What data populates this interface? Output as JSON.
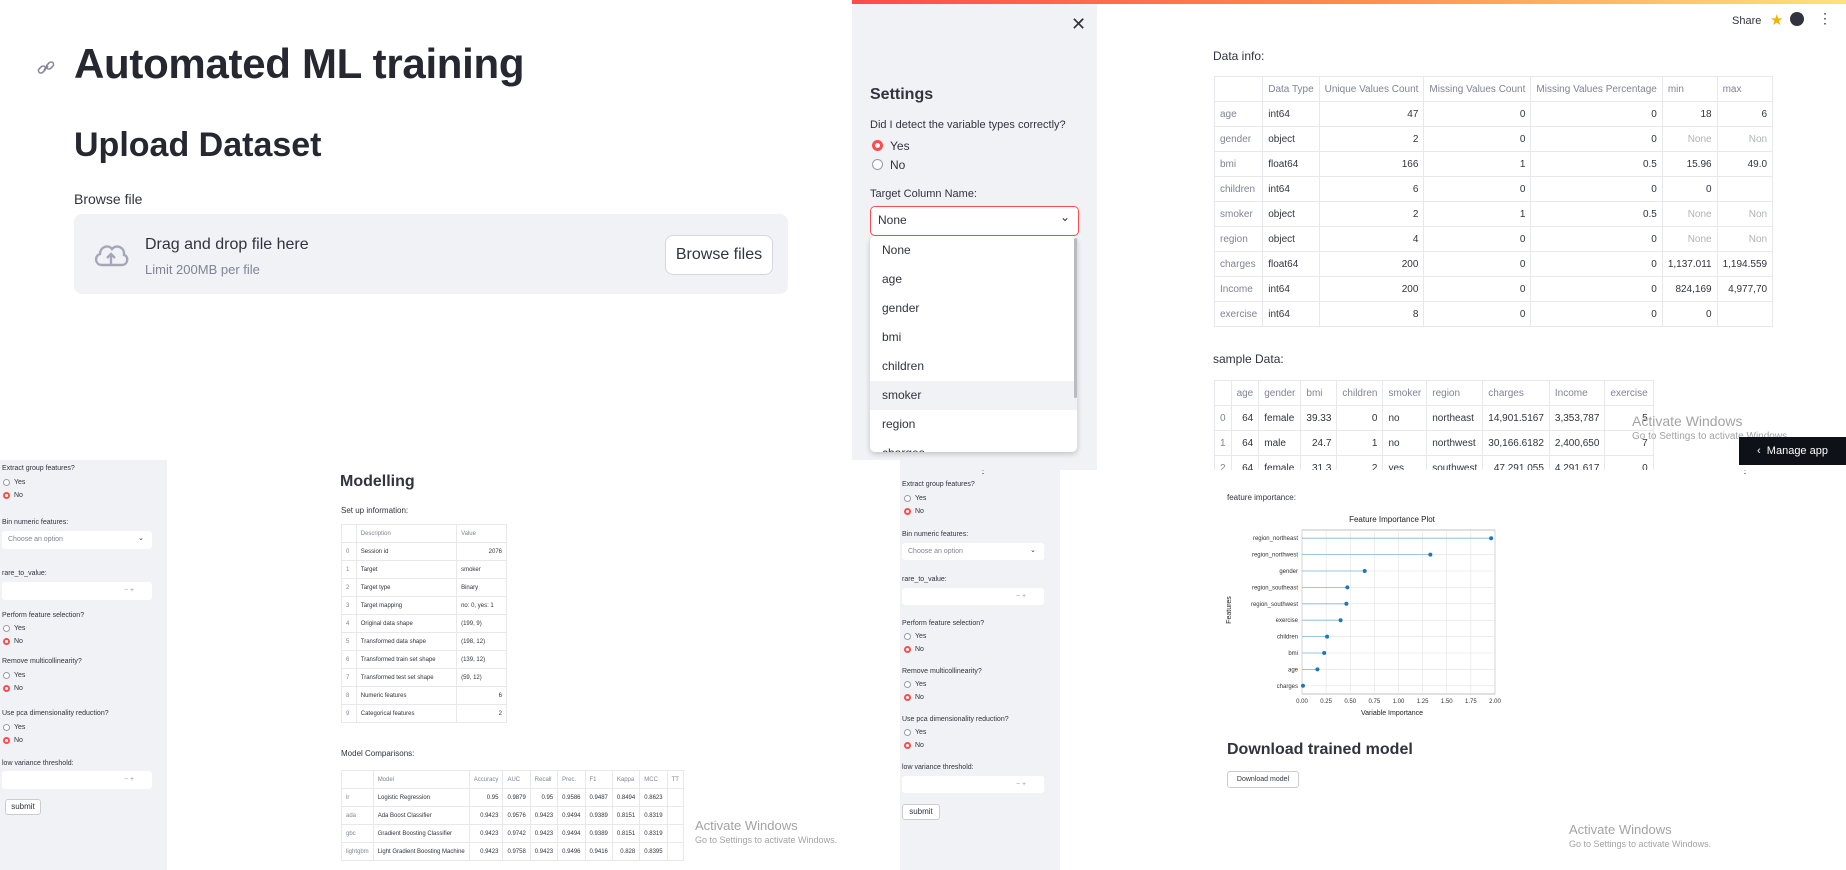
{
  "upload_panel": {
    "title": "Automated ML training",
    "subtitle": "Upload Dataset",
    "browse_label": "Browse file",
    "drop_text": "Drag and drop file here",
    "limit_text": "Limit 200MB per file",
    "browse_button": "Browse files"
  },
  "settings_panel": {
    "header": {
      "share": "Share",
      "manage_app": "Manage app"
    },
    "sidebar": {
      "title": "Settings",
      "question": "Did I detect the variable types correctly?",
      "options": [
        "Yes",
        "No"
      ],
      "selected": "Yes",
      "target_label": "Target Column Name:",
      "target_value": "None",
      "dropdown_options": [
        "None",
        "age",
        "gender",
        "bmi",
        "children",
        "smoker",
        "region",
        "charges"
      ],
      "highlighted_option": "smoker"
    },
    "data_info": {
      "label": "Data info:",
      "columns": [
        "",
        "Data Type",
        "Unique Values Count",
        "Missing Values Count",
        "Missing Values Percentage",
        "min",
        "max"
      ],
      "rows": [
        [
          "age",
          "int64",
          "47",
          "0",
          "0",
          "18",
          "6"
        ],
        [
          "gender",
          "object",
          "2",
          "0",
          "0",
          "None",
          "Non"
        ],
        [
          "bmi",
          "float64",
          "166",
          "1",
          "0.5",
          "15.96",
          "49.0"
        ],
        [
          "children",
          "int64",
          "6",
          "0",
          "0",
          "0",
          ""
        ],
        [
          "smoker",
          "object",
          "2",
          "1",
          "0.5",
          "None",
          "Non"
        ],
        [
          "region",
          "object",
          "4",
          "0",
          "0",
          "None",
          "Non"
        ],
        [
          "charges",
          "float64",
          "200",
          "0",
          "0",
          "1,137.011",
          "1,194.559"
        ],
        [
          "Income",
          "int64",
          "200",
          "0",
          "0",
          "824,169",
          "4,977,70"
        ],
        [
          "exercise",
          "int64",
          "8",
          "0",
          "0",
          "0",
          ""
        ]
      ]
    },
    "sample_data": {
      "label": "sample Data:",
      "columns": [
        "",
        "age",
        "gender",
        "bmi",
        "children",
        "smoker",
        "region",
        "charges",
        "Income",
        "exercise"
      ],
      "rows": [
        [
          "0",
          "64",
          "female",
          "39.33",
          "0",
          "no",
          "northeast",
          "14,901.5167",
          "3,353,787",
          "5"
        ],
        [
          "1",
          "64",
          "male",
          "24.7",
          "1",
          "no",
          "northwest",
          "30,166.6182",
          "2,400,650",
          "7"
        ],
        [
          "2",
          "64",
          "female",
          "31.3",
          "2",
          "yes",
          "southwest",
          "47,291.055",
          "4,291,617",
          "0"
        ]
      ]
    },
    "watermark": {
      "line1": "Activate Windows",
      "line2": "Go to Settings to activate Windows."
    }
  },
  "modelling_panel": {
    "sidebar": {
      "q_group": "Extract group features?",
      "q_bin": "Bin numeric features:",
      "bin_placeholder": "Choose an option",
      "q_rare": "rare_to_value:",
      "q_select": "Perform feature selection?",
      "q_multi": "Remove multicollinearity?",
      "q_pca": "Use pca dimensionality reduction?",
      "q_lowvar": "low variance threshold:",
      "yes": "Yes",
      "no": "No",
      "stepper": "−  +",
      "submit": "submit"
    },
    "title": "Modelling",
    "setup_label": "Set up information:",
    "setup_columns": [
      "",
      "Description",
      "Value"
    ],
    "setup_rows": [
      [
        "0",
        "Session id",
        "2076"
      ],
      [
        "1",
        "Target",
        "smoker"
      ],
      [
        "2",
        "Target type",
        "Binary"
      ],
      [
        "3",
        "Target mapping",
        "no: 0, yes: 1"
      ],
      [
        "4",
        "Original data shape",
        "(199, 9)"
      ],
      [
        "5",
        "Transformed data shape",
        "(198, 12)"
      ],
      [
        "6",
        "Transformed train set shape",
        "(139, 12)"
      ],
      [
        "7",
        "Transformed test set shape",
        "(59, 12)"
      ],
      [
        "8",
        "Numeric features",
        "6"
      ],
      [
        "9",
        "Categorical features",
        "2"
      ]
    ],
    "comp_label": "Model Comparisons:",
    "comp_columns": [
      "",
      "Model",
      "Accuracy",
      "AUC",
      "Recall",
      "Prec.",
      "F1",
      "Kappa",
      "MCC",
      "TT"
    ],
    "comp_rows": [
      [
        "lr",
        "Logistic Regression",
        "0.95",
        "0.9879",
        "0.95",
        "0.9586",
        "0.9487",
        "0.8494",
        "0.8623",
        ""
      ],
      [
        "ada",
        "Ada Boost Classifier",
        "0.9423",
        "0.9576",
        "0.9423",
        "0.9494",
        "0.9389",
        "0.8151",
        "0.8319",
        ""
      ],
      [
        "gbc",
        "Gradient Boosting Classifier",
        "0.9423",
        "0.9742",
        "0.9423",
        "0.9494",
        "0.9389",
        "0.8151",
        "0.8319",
        ""
      ],
      [
        "lightgbm",
        "Light Gradient Boosting Machine",
        "0.9423",
        "0.9758",
        "0.9423",
        "0.9496",
        "0.9416",
        "0.828",
        "0.8395",
        ""
      ]
    ],
    "watermark": {
      "line1": "Activate Windows",
      "line2": "Go to Settings to activate Windows."
    }
  },
  "importance_panel": {
    "label": "feature importance:",
    "download_title": "Download trained model",
    "download_button": "Download model",
    "watermark": {
      "line1": "Activate Windows",
      "line2": "Go to Settings to activate Windows."
    }
  },
  "chart_data": {
    "type": "scatter",
    "title": "Feature Importance Plot",
    "xlabel": "Variable Importance",
    "ylabel": "Features",
    "xlim": [
      0,
      2.0
    ],
    "xticks": [
      "0.00",
      "0.25",
      "0.50",
      "0.75",
      "1.00",
      "1.25",
      "1.50",
      "1.75",
      "2.00"
    ],
    "categories": [
      "region_northeast",
      "region_northwest",
      "gender",
      "region_southeast",
      "region_southwest",
      "exercise",
      "children",
      "bmi",
      "age",
      "charges"
    ],
    "values": [
      1.96,
      1.33,
      0.65,
      0.47,
      0.46,
      0.4,
      0.26,
      0.23,
      0.16,
      0.01
    ],
    "grid": true,
    "color": "#1f77b4"
  }
}
